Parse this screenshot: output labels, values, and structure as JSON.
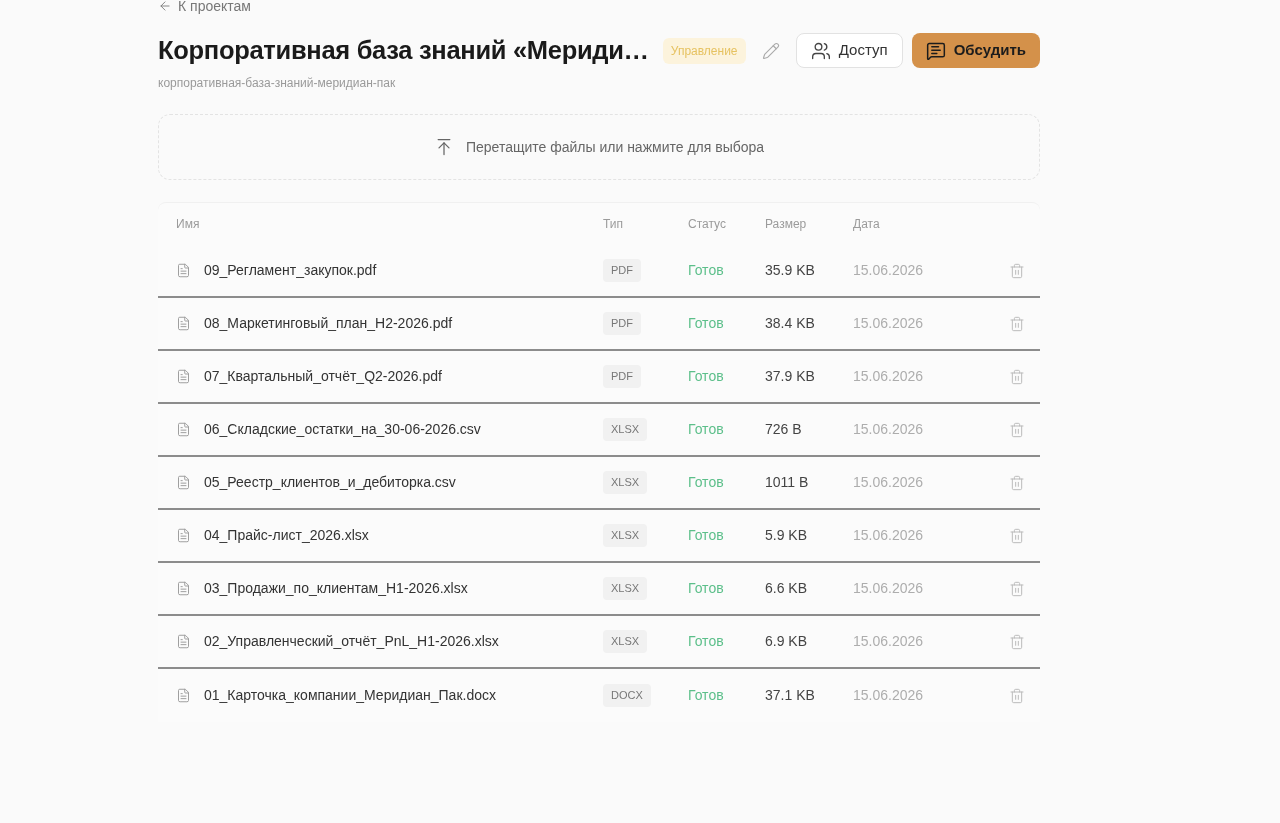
{
  "back_link": {
    "label": "К проектам"
  },
  "header": {
    "title": "Корпоративная база знаний «Мериди…",
    "badge": "Управление",
    "buttons": [
      {
        "label": "Доступ",
        "kind": "secondary"
      },
      {
        "label": "Обсудить",
        "kind": "primary"
      }
    ],
    "slug": "корпоративная-база-знаний-меридиан-пак"
  },
  "dropzone": {
    "label": "Перетащите файлы или нажмите для выбора"
  },
  "table": {
    "columns": [
      "Имя",
      "Тип",
      "Статус",
      "Размер",
      "Дата"
    ],
    "rows": [
      {
        "name": "09_Регламент_закупок.pdf",
        "type": "PDF",
        "status": "Готов",
        "size": "35.9 KB",
        "date": "15.06.2026"
      },
      {
        "name": "08_Маркетинговый_план_H2-2026.pdf",
        "type": "PDF",
        "status": "Готов",
        "size": "38.4 KB",
        "date": "15.06.2026"
      },
      {
        "name": "07_Квартальный_отчёт_Q2-2026.pdf",
        "type": "PDF",
        "status": "Готов",
        "size": "37.9 KB",
        "date": "15.06.2026"
      },
      {
        "name": "06_Складские_остатки_на_30-06-2026.csv",
        "type": "XLSX",
        "status": "Готов",
        "size": "726 B",
        "date": "15.06.2026"
      },
      {
        "name": "05_Реестр_клиентов_и_дебиторка.csv",
        "type": "XLSX",
        "status": "Готов",
        "size": "1011 B",
        "date": "15.06.2026"
      },
      {
        "name": "04_Прайс-лист_2026.xlsx",
        "type": "XLSX",
        "status": "Готов",
        "size": "5.9 KB",
        "date": "15.06.2026"
      },
      {
        "name": "03_Продажи_по_клиентам_H1-2026.xlsx",
        "type": "XLSX",
        "status": "Готов",
        "size": "6.6 KB",
        "date": "15.06.2026"
      },
      {
        "name": "02_Управленческий_отчёт_PnL_H1-2026.xlsx",
        "type": "XLSX",
        "status": "Готов",
        "size": "6.9 KB",
        "date": "15.06.2026"
      },
      {
        "name": "01_Карточка_компании_Меридиан_Пак.docx",
        "type": "DOCX",
        "status": "Готов",
        "size": "37.1 KB",
        "date": "15.06.2026"
      }
    ]
  }
}
